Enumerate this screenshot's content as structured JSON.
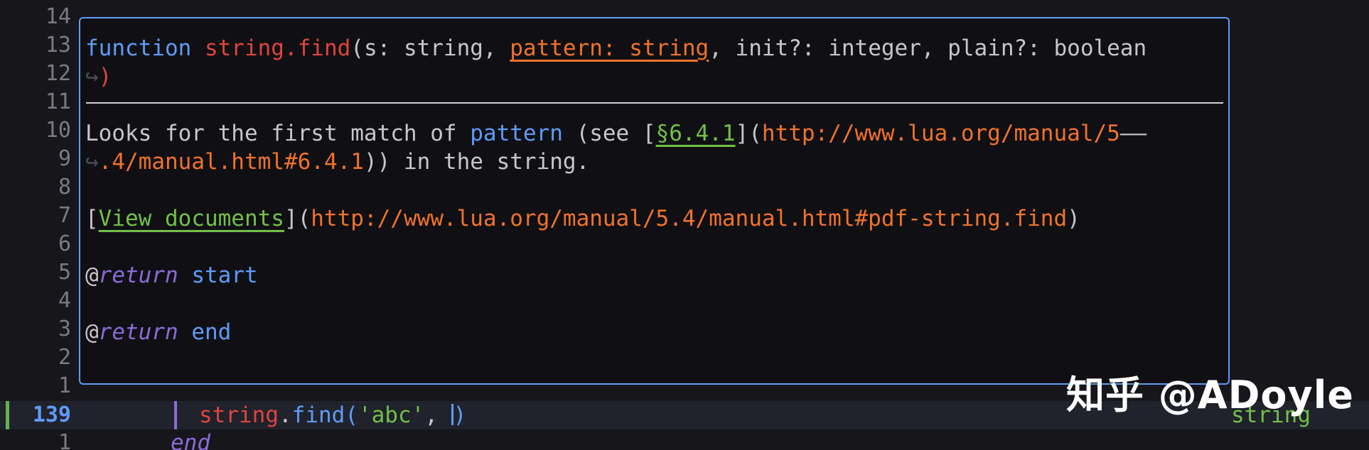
{
  "gutter": {
    "lines": [
      "14",
      "13",
      "12",
      "11",
      "10",
      "9",
      "8",
      "7",
      "6",
      "5",
      "4",
      "3",
      "2",
      "1"
    ],
    "current_line": "139",
    "after_current": "1"
  },
  "hover": {
    "signature": {
      "keyword": "function",
      "name": "string.find",
      "open": "(s: string, ",
      "active_param": "pattern: string",
      "rest": ", init?: integer, plain?: boolean",
      "wrap_glyph": "↪",
      "close": ")"
    },
    "desc": {
      "pre": "Looks for the first match of ",
      "pattern_word": "pattern",
      "see": " (see [",
      "section": "§6.4.1",
      "bracket_paren": "](",
      "url_part1": "http://www.lua.org/manual/5",
      "dash": "——",
      "wrap_glyph": "↪",
      "url_part2": ".4/manual.html#6.4.1",
      "post": ")) in the string."
    },
    "view": {
      "open": "[",
      "link": "View documents",
      "mid": "](",
      "url": "http://www.lua.org/manual/5.4/manual.html#pdf-string.find",
      "close": ")"
    },
    "returns": [
      {
        "at": "@",
        "tag": "return",
        "name": "start"
      },
      {
        "at": "@",
        "tag": "return",
        "name": "end"
      }
    ]
  },
  "code": {
    "obj": "string",
    "dot": ".",
    "method": "find",
    "paren_open": "(",
    "arg": "'abc'",
    "comma": ", ",
    "paren_close": ")",
    "end_keyword": "end"
  },
  "right_fragment": "string",
  "watermark": "知乎 @ADoyle",
  "colors": {
    "background": "#16161b",
    "accent_blue": "#5f9bf7",
    "string_green": "#72c048",
    "url_orange": "#f0722c",
    "keyword_purple": "#8b6bd8",
    "function_red": "#e0443e"
  }
}
